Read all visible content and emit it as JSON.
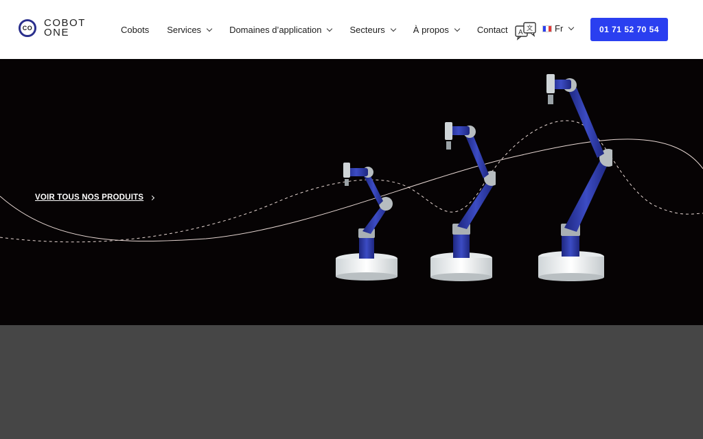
{
  "brand": {
    "logo_mark": "CO",
    "logo_line1": "COBOT",
    "logo_line2": "ONE"
  },
  "nav": {
    "items": [
      {
        "label": "Cobots",
        "has_dropdown": false
      },
      {
        "label": "Services",
        "has_dropdown": true
      },
      {
        "label": "Domaines d’application",
        "has_dropdown": true
      },
      {
        "label": "Secteurs",
        "has_dropdown": true
      },
      {
        "label": "À propos",
        "has_dropdown": true
      },
      {
        "label": "Contact",
        "has_dropdown": false
      }
    ],
    "translate_icon": "translate-icon",
    "language": "Fr",
    "phone": "01 71 52 70 54"
  },
  "hero": {
    "cta_label": "VOIR TOUS NOS PRODUITS",
    "background": "#060304",
    "robot_arm_color": "#2f3ca8"
  },
  "colors": {
    "accent": "#2a3ff0",
    "header_bg": "#ffffff",
    "lower_section": "#464646"
  }
}
